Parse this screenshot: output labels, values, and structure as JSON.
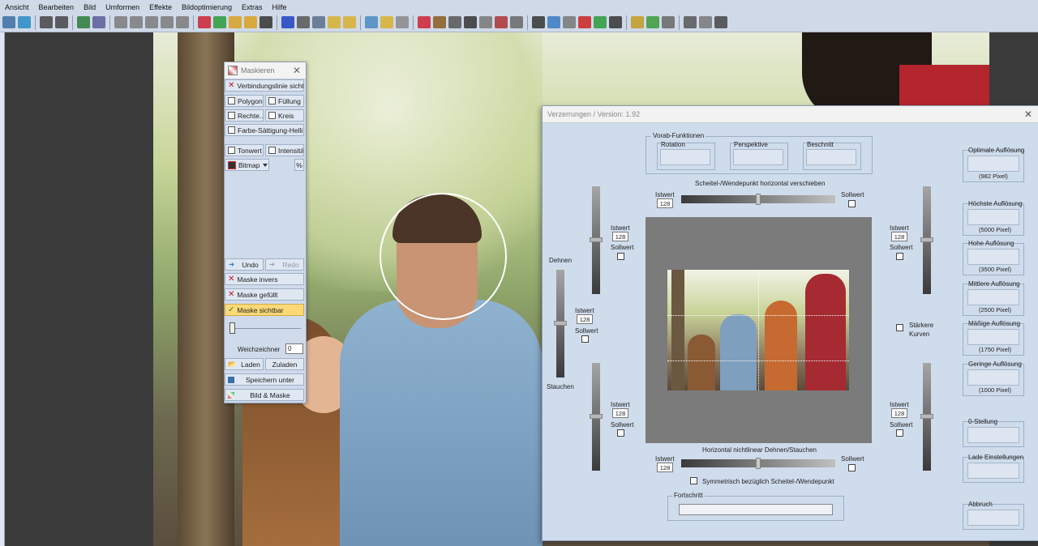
{
  "menu": [
    "Ansicht",
    "Bearbeiten",
    "Bild",
    "Umformen",
    "Effekte",
    "Bildoptimierung",
    "Extras",
    "Hilfe"
  ],
  "toolbar_icons": [
    "layout-icon",
    "refresh-icon",
    "undo-icon",
    "redo-icon",
    "select-icon",
    "grid-icon",
    "rect-icon",
    "rect-icon",
    "rect-icon",
    "rect-icon",
    "rect-icon",
    "crop-icon",
    "rotate-icon",
    "face-icon",
    "3d-face-icon",
    "ie-icon",
    "pc-icon",
    "table-icon",
    "image-icon",
    "frame-icon",
    "frame-icon",
    "chart-icon",
    "frame-icon",
    "image-icon",
    "crop-icon",
    "zoom-icon",
    "circle-icon",
    "text-icon",
    "rect-icon",
    "pattern-icon",
    "save-icon",
    "burst-icon",
    "paint-icon",
    "histogram-icon",
    "rgb-icon",
    "color-wheel-icon",
    "ie-icon",
    "grid-icon",
    "image-icon",
    "hash-icon",
    "panel-icon",
    "panel-icon",
    "scissors-icon"
  ],
  "mask_panel": {
    "title": "Maskieren",
    "connection_line": "Verbindungslinie sicht...",
    "polygon": "Polygon",
    "fill": "Füllung",
    "rect": "Rechte...",
    "circle": "Kreis",
    "color_sat": "Farbe-Sättigung-Helli...",
    "tone": "Tonwert",
    "intensity": "Intensität",
    "bitmap": "Bitmap",
    "percent": "%",
    "undo": "Undo",
    "redo": "Redo",
    "mask_invert": "Maske invers",
    "mask_filled": "Maske gefüllt",
    "mask_visible": "Maske sichtbar",
    "soft_label": "Weichzeichner",
    "soft_value": "0",
    "load": "Laden",
    "add": "Zuladen",
    "save_as": "Speichern unter",
    "image_mask": "Bild & Maske"
  },
  "dialog": {
    "title": "Verzerrungen / Version: 1.92",
    "pre_functions": "Vorab-Funktionen",
    "rotation": "Rotation",
    "perspective": "Perspektive",
    "crop": "Beschnitt",
    "h_shift": "Scheitel-/Wendepunkt horizontal verschieben",
    "h_stretch": "Horizontal nichtlinear Dehnen/Stauchen",
    "symmetric": "Symmetrisch bezüglich Scheitel-/Wendepunkt",
    "progress": "Fortschritt",
    "stretch": "Dehnen",
    "compress": "Stauchen",
    "stronger_curves": "Stärkere Kurven",
    "istwert": "Istwert",
    "sollwert": "Sollwert",
    "value": "128"
  },
  "resolutions": [
    {
      "label": "Optimale Auflösung",
      "sub": "(982 Pixel)"
    },
    {
      "label": "Höchste Auflösung",
      "sub": "(5000 Pixel)"
    },
    {
      "label": "Hohe Auflösung",
      "sub": "(3500 Pixel)"
    },
    {
      "label": "Mittlere Auflösung",
      "sub": "(2500 Pixel)"
    },
    {
      "label": "Mäßige Auflösung",
      "sub": "(1750 Pixel)"
    },
    {
      "label": "Geringe Auflösung",
      "sub": "(1000 Pixel)"
    }
  ],
  "right_buttons": {
    "zero": "0-Stellung",
    "load": "Lade Einstellungen",
    "cancel": "Abbruch"
  }
}
